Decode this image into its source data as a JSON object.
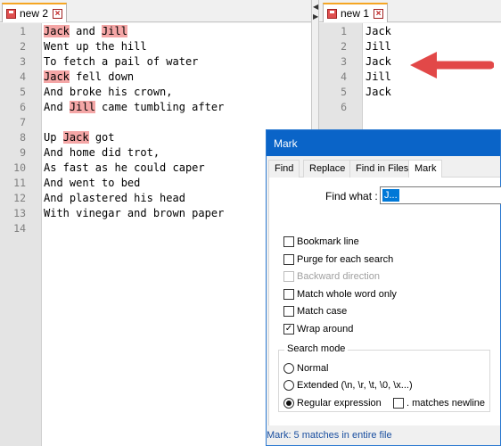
{
  "left_tab": {
    "label": "new 2"
  },
  "right_tab": {
    "label": "new 1"
  },
  "left_editor": {
    "lines": [
      {
        "num": "1",
        "segments": [
          {
            "text": "Jack",
            "hl": true
          },
          {
            "text": " and ",
            "hl": false
          },
          {
            "text": "Jill",
            "hl": true
          }
        ]
      },
      {
        "num": "2",
        "segments": [
          {
            "text": "Went up the hill",
            "hl": false
          }
        ]
      },
      {
        "num": "3",
        "segments": [
          {
            "text": "To fetch a pail of water",
            "hl": false
          }
        ]
      },
      {
        "num": "4",
        "segments": [
          {
            "text": "Jack",
            "hl": true
          },
          {
            "text": " fell down",
            "hl": false
          }
        ]
      },
      {
        "num": "5",
        "segments": [
          {
            "text": "And broke his crown,",
            "hl": false
          }
        ]
      },
      {
        "num": "6",
        "segments": [
          {
            "text": "And ",
            "hl": false
          },
          {
            "text": "Jill",
            "hl": true
          },
          {
            "text": " came tumbling after",
            "hl": false
          }
        ]
      },
      {
        "num": "7",
        "segments": []
      },
      {
        "num": "8",
        "segments": [
          {
            "text": "Up ",
            "hl": false
          },
          {
            "text": "Jack",
            "hl": true
          },
          {
            "text": " got",
            "hl": false
          }
        ]
      },
      {
        "num": "9",
        "segments": [
          {
            "text": "And home did trot,",
            "hl": false
          }
        ]
      },
      {
        "num": "10",
        "segments": [
          {
            "text": "As fast as he could caper",
            "hl": false
          }
        ]
      },
      {
        "num": "11",
        "segments": [
          {
            "text": "And went to bed",
            "hl": false
          }
        ]
      },
      {
        "num": "12",
        "segments": [
          {
            "text": "And plastered his head",
            "hl": false
          }
        ]
      },
      {
        "num": "13",
        "segments": [
          {
            "text": "With vinegar and brown paper",
            "hl": false
          }
        ]
      },
      {
        "num": "14",
        "segments": []
      }
    ]
  },
  "right_editor": {
    "lines": [
      {
        "num": "1",
        "text": "Jack"
      },
      {
        "num": "2",
        "text": "Jill"
      },
      {
        "num": "3",
        "text": "Jack"
      },
      {
        "num": "4",
        "text": "Jill"
      },
      {
        "num": "5",
        "text": "Jack"
      },
      {
        "num": "6",
        "text": ""
      }
    ]
  },
  "dialog": {
    "title": "Mark",
    "tabs": [
      "Find",
      "Replace",
      "Find in Files",
      "Mark"
    ],
    "active_tab": "Mark",
    "find_label": "Find what :",
    "find_value": "J...",
    "options": [
      {
        "label": "Bookmark line",
        "checked": false,
        "disabled": false
      },
      {
        "label": "Purge for each search",
        "checked": false,
        "disabled": false
      },
      {
        "label": "Backward direction",
        "checked": false,
        "disabled": true
      },
      {
        "label": "Match whole word only",
        "checked": false,
        "disabled": false
      },
      {
        "label": "Match case",
        "checked": false,
        "disabled": false
      },
      {
        "label": "Wrap around",
        "checked": true,
        "disabled": false
      }
    ],
    "search_mode_label": "Search mode",
    "modes": {
      "normal": "Normal",
      "extended": "Extended (\\n, \\r, \\t, \\0, \\x...)",
      "regex": "Regular expression",
      "selected": "regex"
    },
    "matches_newline_label": ". matches newline",
    "status": "Mark: 5 matches in entire file"
  },
  "colors": {
    "highlight": "#f4a6a6",
    "arrow": "#e24848",
    "title_bar": "#0a64c8"
  }
}
